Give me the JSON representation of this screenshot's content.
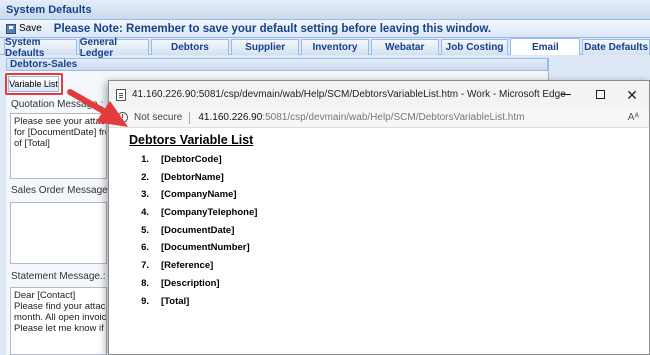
{
  "window": {
    "title": "System Defaults"
  },
  "toolbar": {
    "save_label": "Save",
    "note": "Please Note: Remember to save your default setting before leaving this window."
  },
  "tabs": [
    {
      "label": "System Defaults"
    },
    {
      "label": "General Ledger"
    },
    {
      "label": "Debtors"
    },
    {
      "label": "Supplier"
    },
    {
      "label": "Inventory"
    },
    {
      "label": "Webatar"
    },
    {
      "label": "Job Costing"
    },
    {
      "label": "Email",
      "active": true
    },
    {
      "label": "Date Defaults"
    }
  ],
  "section": {
    "title": "Debtors-Sales"
  },
  "variable_list_button": "Variable List",
  "fields": {
    "quotation": {
      "label": "Quotation Message.:",
      "value": "Please see your attache\nfor [DocumentDate] from\nof [Total]"
    },
    "sales_order": {
      "label": "Sales Order Message.:",
      "value": ""
    },
    "statement": {
      "label": "Statement Message.:",
      "value": "Dear [Contact]\nPlease find your attached\nmonth. All open invoices a\nPlease let me know if you"
    }
  },
  "edge": {
    "title": "41.160.226.90:5081/csp/devmain/wab/Help/SCM/DebtorsVariableList.htm - Work - Microsoft Edge",
    "not_secure": "Not secure",
    "url_host": "41.160.226.90",
    "url_path": ":5081/csp/devmain/wab/Help/SCM/DebtorsVariableList.htm",
    "read_aloud": "Aᴬ"
  },
  "doc": {
    "title": "Debtors Variable List",
    "items": [
      {
        "num": "1.",
        "name": "[DebtorCode]"
      },
      {
        "num": "2.",
        "name": "[DebtorName]"
      },
      {
        "num": "3.",
        "name": "[CompanyName]"
      },
      {
        "num": "4.",
        "name": "[CompanyTelephone]"
      },
      {
        "num": "5.",
        "name": "[DocumentDate]"
      },
      {
        "num": "6.",
        "name": "[DocumentNumber]"
      },
      {
        "num": "7.",
        "name": "[Reference]"
      },
      {
        "num": "8.",
        "name": "[Description]"
      },
      {
        "num": "9.",
        "name": "[Total]"
      }
    ]
  },
  "colors": {
    "callout": "#e33b3b",
    "panel_border": "#99bbe8",
    "header_text": "#15428b"
  }
}
